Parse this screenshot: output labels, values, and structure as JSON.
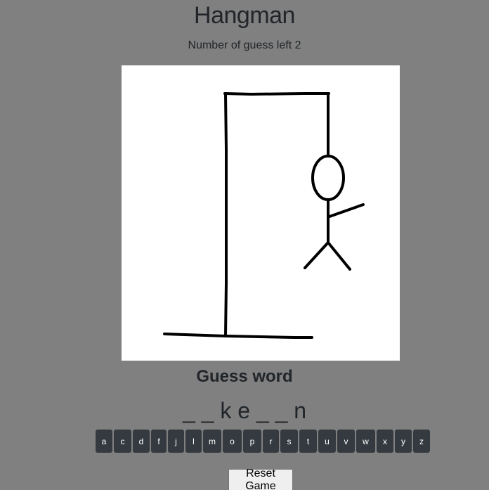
{
  "header": {
    "title": "Hangman",
    "guesses_left": "Number of guess left 2"
  },
  "game": {
    "guess_heading": "Guess word",
    "masked_word": "_ _ k e _ _ n",
    "letters": [
      "a",
      "c",
      "d",
      "f",
      "j",
      "l",
      "m",
      "o",
      "p",
      "r",
      "s",
      "t",
      "u",
      "v",
      "w",
      "x",
      "y",
      "z"
    ]
  },
  "controls": {
    "reset_label": "Reset Game"
  },
  "drawing": {
    "stroke_color": "#000000",
    "parts": [
      "gallows",
      "head",
      "body",
      "right-arm",
      "left-leg",
      "right-leg"
    ]
  }
}
